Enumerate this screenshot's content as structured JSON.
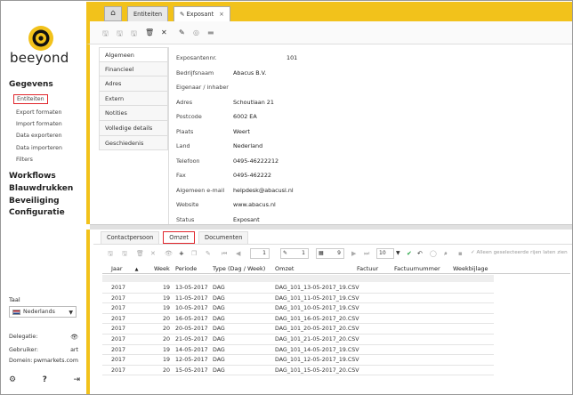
{
  "brand": {
    "name": "beeyond"
  },
  "sidebar": {
    "gegevens": "Gegevens",
    "gegevens_items": [
      "Entiteiten",
      "Export formaten",
      "Import formaten",
      "Data exporteren",
      "Data importeren",
      "Filters"
    ],
    "workflows": "Workflows",
    "blauwdrukken": "Blauwdrukken",
    "beveiliging": "Beveiliging",
    "configuratie": "Configuratie",
    "taal_label": "Taal",
    "taal_value": "Nederlands",
    "delegatie_label": "Delegatie:",
    "gebruiker_label": "Gebruiker:",
    "gebruiker_value": "art",
    "domein_label": "Domein:",
    "domein_value": "pwmarkets.com"
  },
  "tabs": [
    {
      "label": "Entiteiten"
    },
    {
      "label": "Exposant",
      "close": "×"
    }
  ],
  "side_tabs": [
    "Algemeen",
    "Financieel",
    "Adres",
    "Extern",
    "Notities",
    "Volledige details",
    "Geschiedenis"
  ],
  "form": {
    "fields": [
      {
        "label": "Exposantennr.",
        "value": "101"
      },
      {
        "label": "Bedrijfsnaam",
        "value": "Abacus B.V."
      },
      {
        "label": "Eigenaar / inhaber",
        "value": ""
      },
      {
        "label": "Adres",
        "value": "Schoutlaan 21"
      },
      {
        "label": "Postcode",
        "value": "6002 EA"
      },
      {
        "label": "Plaats",
        "value": "Weert"
      },
      {
        "label": "Land",
        "value": "Nederland"
      },
      {
        "label": "Telefoon",
        "value": "0495-46222212"
      },
      {
        "label": "Fax",
        "value": "0495-462222"
      },
      {
        "label": "Algemeen e-mail",
        "value": "helpdesk@abacusl.nl"
      },
      {
        "label": "Website",
        "value": "www.abacus.nl"
      },
      {
        "label": "Status",
        "value": "Exposant"
      }
    ]
  },
  "bottom_tabs": [
    "Contactpersoon",
    "Omzet",
    "Documenten"
  ],
  "grid_toolbar": {
    "page": "1",
    "of_pages": "1",
    "records": "9",
    "rows": "10",
    "filter_text": "Alleen geselecteerde rijen laten zien"
  },
  "grid": {
    "columns": [
      "Jaar",
      "Week",
      "Periode",
      "Type (Dag / Week)",
      "Omzet",
      "Factuur",
      "Factuurnummer",
      "Weekbijlage"
    ],
    "sort_indicator": "▲",
    "rows": [
      [
        "2017",
        "19",
        "13-05-2017",
        "DAG",
        "DAG_101_13-05-2017_19.CSV"
      ],
      [
        "2017",
        "19",
        "11-05-2017",
        "DAG",
        "DAG_101_11-05-2017_19.CSV"
      ],
      [
        "2017",
        "19",
        "10-05-2017",
        "DAG",
        "DAG_101_10-05-2017_19.CSV"
      ],
      [
        "2017",
        "20",
        "16-05-2017",
        "DAG",
        "DAG_101_16-05-2017_20.CSV"
      ],
      [
        "2017",
        "20",
        "20-05-2017",
        "DAG",
        "DAG_101_20-05-2017_20.CSV"
      ],
      [
        "2017",
        "20",
        "21-05-2017",
        "DAG",
        "DAG_101_21-05-2017_20.CSV"
      ],
      [
        "2017",
        "19",
        "14-05-2017",
        "DAG",
        "DAG_101_14-05-2017_19.CSV"
      ],
      [
        "2017",
        "19",
        "12-05-2017",
        "DAG",
        "DAG_101_12-05-2017_19.CSV"
      ],
      [
        "2017",
        "20",
        "15-05-2017",
        "DAG",
        "DAG_101_15-05-2017_20.CSV"
      ]
    ]
  },
  "colors": {
    "accent": "#f2c21b",
    "highlight": "#e0262c"
  }
}
